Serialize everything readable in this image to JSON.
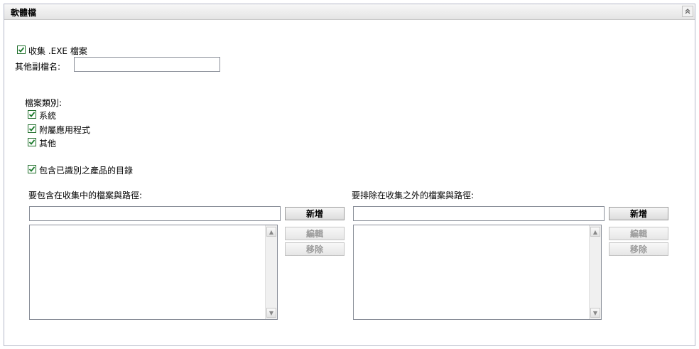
{
  "panel": {
    "title": "軟體檔",
    "collapse_glyph": "≈"
  },
  "collect_exe": {
    "label": "收集 .EXE 檔案",
    "checked": true
  },
  "other_ext": {
    "label": "其他副檔名:",
    "value": ""
  },
  "categories": {
    "heading": "檔案類別:",
    "items": [
      {
        "label": "系統",
        "checked": true
      },
      {
        "label": "附屬應用程式",
        "checked": true
      },
      {
        "label": "其他",
        "checked": true
      }
    ]
  },
  "include_product_dirs": {
    "label": "包含已識別之產品的目錄",
    "checked": true
  },
  "include_section": {
    "label": "要包含在收集中的檔案與路徑:",
    "input_value": "",
    "add_label": "新增",
    "edit_label": "編輯",
    "remove_label": "移除"
  },
  "exclude_section": {
    "label": "要排除在收集之外的檔案與路徑:",
    "input_value": "",
    "add_label": "新增",
    "edit_label": "編輯",
    "remove_label": "移除"
  }
}
